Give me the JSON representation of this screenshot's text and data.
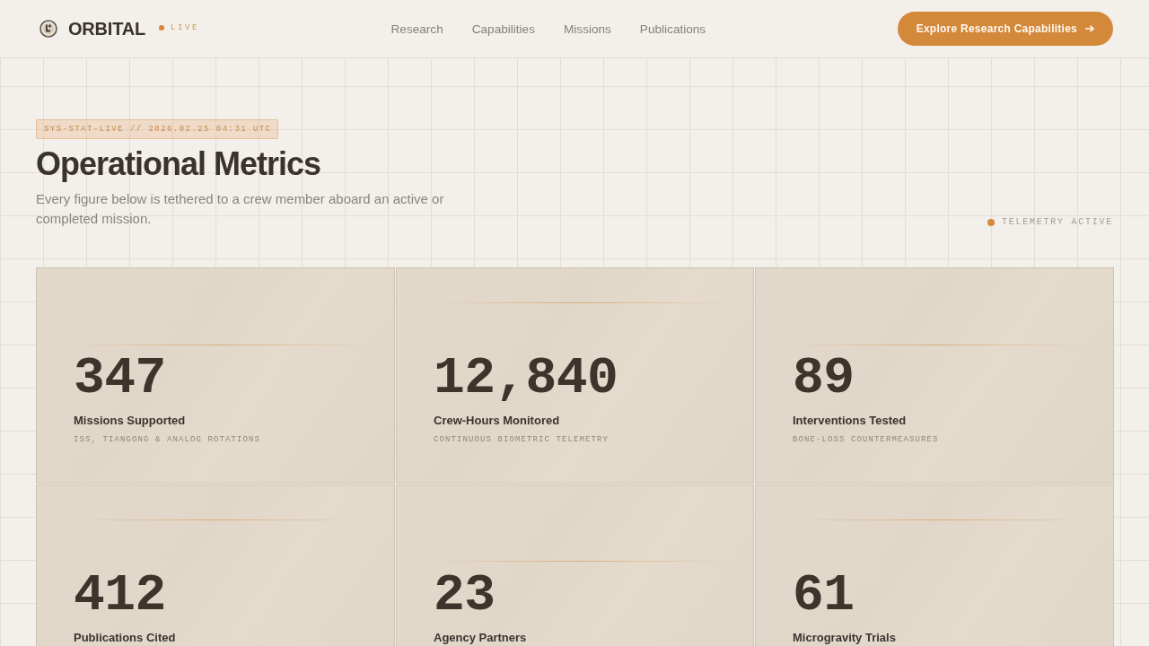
{
  "header": {
    "logo": {
      "name": "ORBITAL",
      "badge": "LIVE"
    },
    "nav": [
      "Research",
      "Capabilities",
      "Missions",
      "Publications"
    ],
    "cta": "Explore Research Capabilities"
  },
  "intro": {
    "tag": "SYS-STAT-LIVE // 2026.02.25 04:31 UTC",
    "title": "Operational Metrics",
    "subtitle": "Every figure below is tethered to a crew member aboard an active or completed mission.",
    "status": "TELEMETRY ACTIVE"
  },
  "metrics": [
    {
      "value": "347",
      "label": "Missions Supported",
      "note": "ISS, TIANGONG & ANALOG ROTATIONS"
    },
    {
      "value": "12,840",
      "label": "Crew-Hours Monitored",
      "note": "CONTINUOUS BIOMETRIC TELEMETRY"
    },
    {
      "value": "89",
      "label": "Interventions Tested",
      "note": "BONE-LOSS COUNTERMEASURES"
    },
    {
      "value": "412",
      "label": "Publications Cited"
    },
    {
      "value": "23",
      "label": "Agency Partners"
    },
    {
      "value": "61",
      "label": "Microgravity Trials"
    }
  ]
}
